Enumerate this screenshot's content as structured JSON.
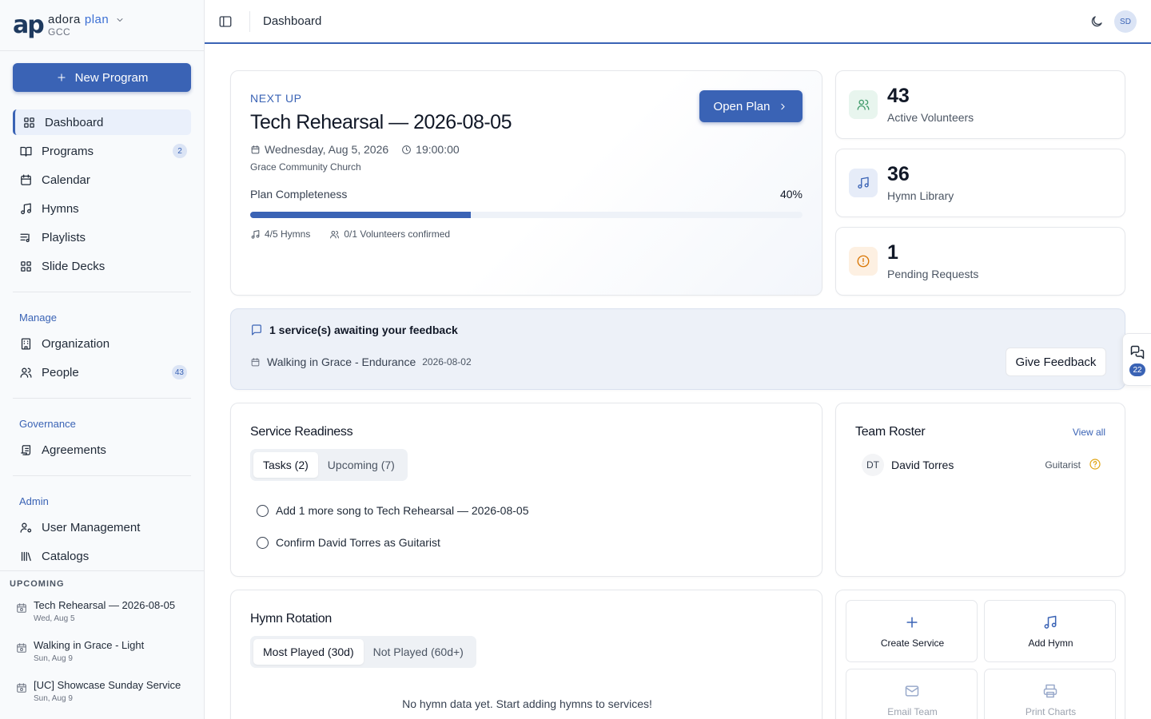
{
  "brand": {
    "logo_text": "ap",
    "name": "adora",
    "name_accent": "plan",
    "org": "GCC"
  },
  "sidebar": {
    "new_program_label": "New Program",
    "nav": [
      {
        "label": "Dashboard",
        "icon": "grid-icon",
        "active": true
      },
      {
        "label": "Programs",
        "icon": "book-icon",
        "badge": "2"
      },
      {
        "label": "Calendar",
        "icon": "calendar-icon"
      },
      {
        "label": "Hymns",
        "icon": "music-icon"
      },
      {
        "label": "Playlists",
        "icon": "playlist-icon"
      },
      {
        "label": "Slide Decks",
        "icon": "grid-icon"
      }
    ],
    "sections": {
      "manage": {
        "title": "Manage",
        "items": [
          {
            "label": "Organization",
            "icon": "building-icon"
          },
          {
            "label": "People",
            "icon": "users-icon",
            "badge": "43"
          }
        ]
      },
      "governance": {
        "title": "Governance",
        "items": [
          {
            "label": "Agreements",
            "icon": "scroll-icon"
          }
        ]
      },
      "admin": {
        "title": "Admin",
        "items": [
          {
            "label": "User Management",
            "icon": "user-cog-icon"
          },
          {
            "label": "Catalogs",
            "icon": "library-icon"
          }
        ]
      }
    },
    "upcoming": {
      "title": "UPCOMING",
      "items": [
        {
          "name": "Tech Rehearsal — 2026-08-05",
          "date": "Wed, Aug 5"
        },
        {
          "name": "Walking in Grace - Light",
          "date": "Sun, Aug 9"
        },
        {
          "name": "[UC] Showcase Sunday Service",
          "date": "Sun, Aug 9"
        }
      ]
    }
  },
  "header": {
    "title": "Dashboard",
    "avatar_initials": "SD"
  },
  "next_up": {
    "label": "NEXT UP",
    "title": "Tech Rehearsal — 2026-08-05",
    "date": "Wednesday, Aug 5, 2026",
    "time": "19:00:00",
    "church": "Grace Community Church",
    "open_label": "Open Plan",
    "completeness_label": "Plan Completeness",
    "completeness_value": "40%",
    "completeness_fraction": 0.4,
    "hymns_stat": "4/5 Hymns",
    "volunteers_stat": "0/1 Volunteers confirmed"
  },
  "stats": [
    {
      "value": "43",
      "label": "Active Volunteers",
      "icon": "users-icon",
      "color": "#3f9a6a",
      "bg": "#e8f5ee"
    },
    {
      "value": "36",
      "label": "Hymn Library",
      "icon": "music-icon",
      "color": "#3a63b5",
      "bg": "#e6ecf8"
    },
    {
      "value": "1",
      "label": "Pending Requests",
      "icon": "alert-circle-icon",
      "color": "#d97706",
      "bg": "#fdf0e2"
    }
  ],
  "feedback": {
    "title": "1 service(s) awaiting your feedback",
    "item_name": "Walking in Grace - Endurance",
    "item_date": "2026-08-02",
    "button_label": "Give Feedback"
  },
  "floating_chat": {
    "badge": "22"
  },
  "readiness": {
    "title": "Service Readiness",
    "tabs": [
      {
        "label": "Tasks (2)",
        "active": true
      },
      {
        "label": "Upcoming (7)"
      }
    ],
    "tasks": [
      "Add 1 more song to Tech Rehearsal — 2026-08-05",
      "Confirm David Torres as Guitarist"
    ]
  },
  "roster": {
    "title": "Team Roster",
    "view_all": "View all",
    "members": [
      {
        "initials": "DT",
        "name": "David Torres",
        "role": "Guitarist"
      }
    ]
  },
  "hymn_rotation": {
    "title": "Hymn Rotation",
    "tabs": [
      {
        "label": "Most Played (30d)",
        "active": true
      },
      {
        "label": "Not Played (60d+)"
      }
    ],
    "empty_message": "No hymn data yet. Start adding hymns to services!"
  },
  "quick_actions": [
    {
      "label": "Create Service",
      "icon": "plus-icon"
    },
    {
      "label": "Add Hymn",
      "icon": "music-icon"
    },
    {
      "label": "Email Team",
      "icon": "mail-icon"
    },
    {
      "label": "Print Charts",
      "icon": "printer-icon"
    }
  ]
}
